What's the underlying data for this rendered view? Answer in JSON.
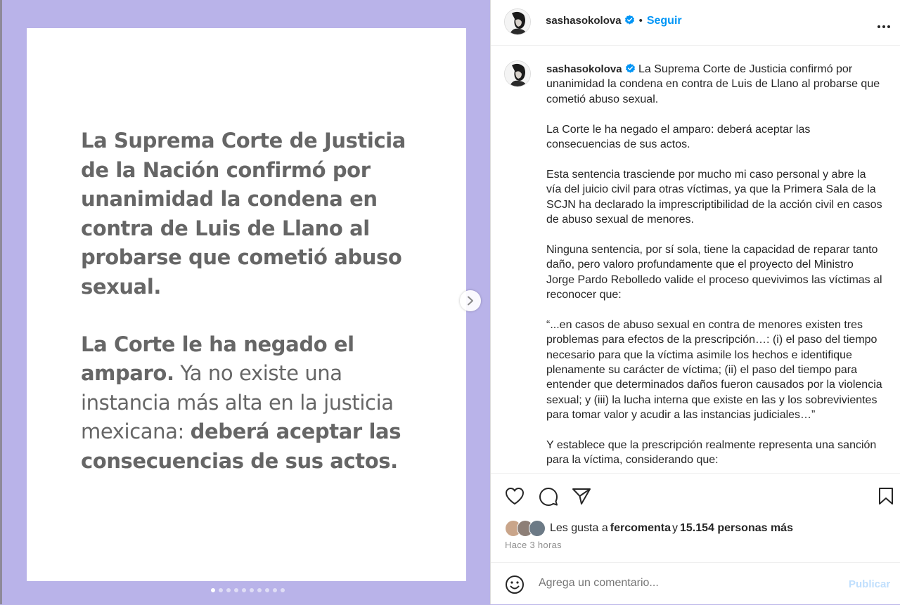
{
  "post_image": {
    "paragraph1": "La Suprema Corte de Justicia de la Nación confirmó por unanimidad la condena en contra de Luis de Llano al probarse que cometió abuso sexual.",
    "p2_bold1": "La Corte le ha negado el amparo.",
    "p2_regular": " Ya no existe una instancia más alta en la justicia mexicana: ",
    "p2_bold2": "deberá aceptar las consecuencias de sus actos.",
    "slide_count": 10,
    "active_slide": 1
  },
  "header": {
    "username": "sashasokolova",
    "separator": "•",
    "follow_label": "Seguir"
  },
  "caption": {
    "username": "sashasokolova",
    "paragraphs": [
      "La Suprema Corte de Justicia confirmó por unanimidad la condena en contra de Luis de Llano al probarse que cometió abuso sexual.",
      "La Corte le ha negado el amparo: deberá aceptar las consecuencias de sus actos.",
      "Esta sentencia trasciende por mucho mi caso personal y abre la vía del juicio civil para otras víctimas, ya que la Primera Sala de la SCJN ha declarado la imprescriptibilidad de la acción civil en casos de abuso sexual de menores.",
      "Ninguna sentencia, por sí sola, tiene la capacidad de reparar tanto daño, pero valoro profundamente que el proyecto del Ministro Jorge Pardo Rebolledo valide el proceso quevivimos las víctimas al reconocer que:",
      "“...en casos de abuso sexual en contra de menores existen tres problemas para efectos de la prescripción…: (i) el paso del tiempo necesario para que la víctima asimile los hechos e identifique plenamente su carácter de víctima; (ii) el paso del tiempo para entender que determinados daños fueron causados por la violencia sexual; y (iii) la lucha interna que existe en las y los sobrevivientes para tomar valor y acudir a las instancias judiciales…”",
      "Y establece que la prescripción realmente representa una sanción para la víctima, considerando que:"
    ]
  },
  "likes": {
    "prefix": "Les gusta a ",
    "user": "fercomenta",
    "connector": " y ",
    "others": "15.154 personas más"
  },
  "time_ago": "Hace 3 horas",
  "comment": {
    "placeholder": "Agrega un comentario...",
    "publish_label": "Publicar"
  },
  "colors": {
    "background": "#b9b3e9",
    "accent": "#0095f6",
    "verified": "#0095f6",
    "publish_disabled": "#c0dffd"
  }
}
